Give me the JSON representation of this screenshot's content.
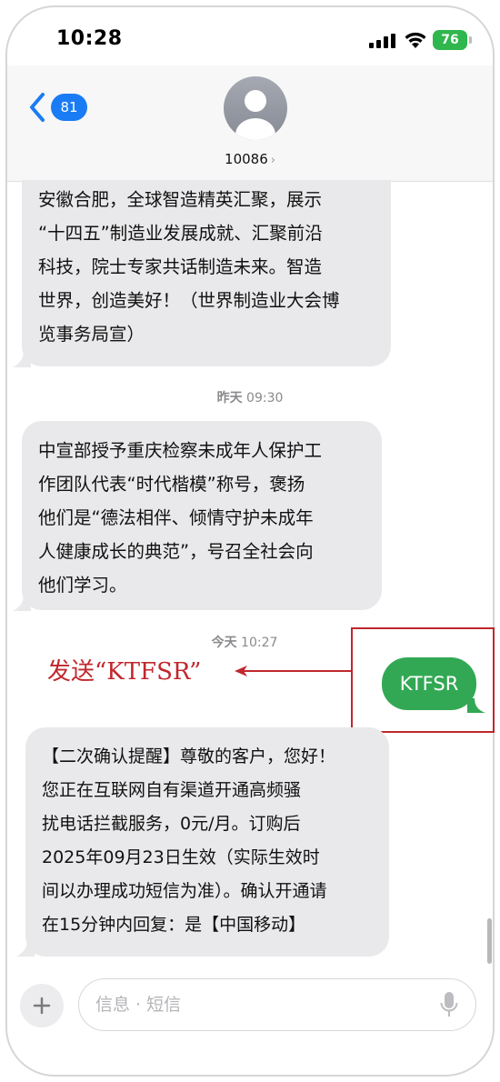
{
  "status_bar": {
    "time": "10:28",
    "battery": "76"
  },
  "header": {
    "back_count": "81",
    "contact": "10086",
    "contact_chevron": "›"
  },
  "messages": [
    {
      "lines": "安徽合肥，全球智造精英汇聚，展示\n“十四五”制造业发展成就、汇聚前沿\n科技，院士专家共话制造未来。智造\n世界，创造美好！（世界制造业大会博\n览事务局宣）"
    },
    {
      "lines": "中宣部授予重庆检察未成年人保护工\n作团队代表“时代楷模”称号，褒扬\n他们是“德法相伴、倾情守护未成年\n人健康成长的典范”，号召全社会向\n他们学习。"
    },
    {
      "lines": "【二次确认提醒】尊敬的客户，您好！\n您正在互联网自有渠道开通高频骚\n扰电话拦截服务，0元/月。订购后\n 2025年09月23日生效（实际生效时\n间以办理成功短信为准）。确认开通请\n在15分钟内回复：是【中国移动】"
    }
  ],
  "timestamps": [
    {
      "day": "昨天",
      "time": "09:30"
    },
    {
      "day": "今天",
      "time": "10:27"
    }
  ],
  "sent_message": "KTFSR",
  "annotation": "发送“KTFSR”",
  "input": {
    "placeholder": "信息 · 短信"
  },
  "colors": {
    "accent": "#1a7cf5",
    "sent_bubble": "#32a854",
    "annotation": "#c0272d",
    "battery": "#2fb64c"
  },
  "icons": [
    "signal-icon",
    "wifi-icon",
    "battery-icon",
    "back-chevron-icon",
    "person-icon",
    "plus-icon",
    "mic-icon",
    "arrow-icon"
  ]
}
